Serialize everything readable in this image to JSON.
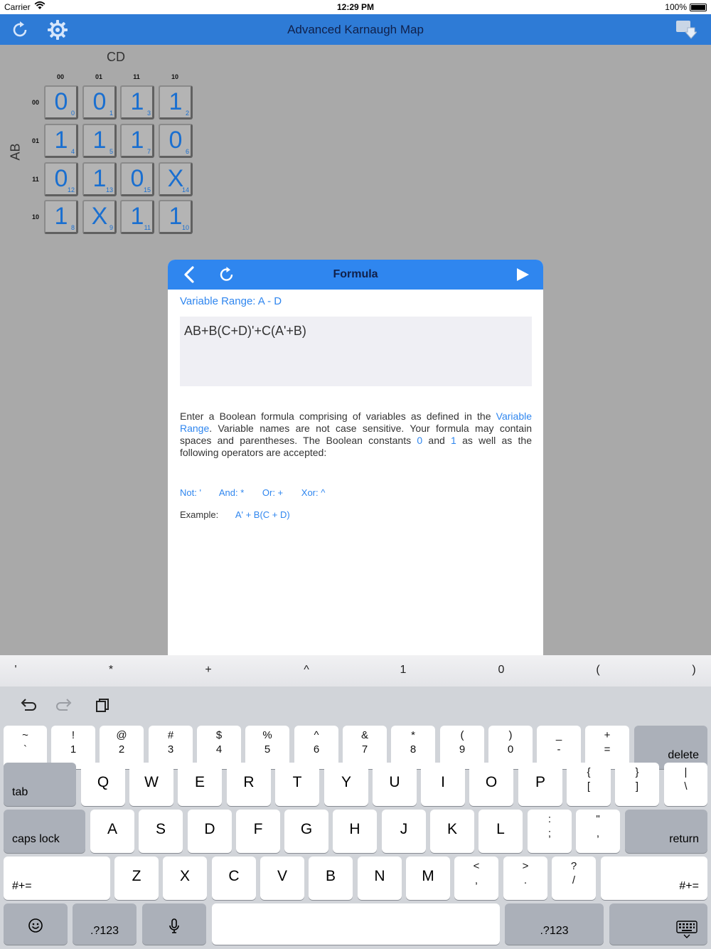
{
  "status_bar": {
    "carrier": "Carrier",
    "time": "12:29 PM",
    "battery": "100%"
  },
  "nav": {
    "title": "Advanced Karnaugh Map"
  },
  "kmap": {
    "col_var": "CD",
    "row_var": "AB",
    "col_headers": [
      "00",
      "01",
      "11",
      "10"
    ],
    "row_headers": [
      "00",
      "01",
      "11",
      "10"
    ],
    "cells": [
      [
        {
          "v": "0",
          "i": "0"
        },
        {
          "v": "0",
          "i": "1"
        },
        {
          "v": "1",
          "i": "3"
        },
        {
          "v": "1",
          "i": "2"
        }
      ],
      [
        {
          "v": "1",
          "i": "4"
        },
        {
          "v": "1",
          "i": "5"
        },
        {
          "v": "1",
          "i": "7"
        },
        {
          "v": "0",
          "i": "6"
        }
      ],
      [
        {
          "v": "0",
          "i": "12"
        },
        {
          "v": "1",
          "i": "13"
        },
        {
          "v": "0",
          "i": "15"
        },
        {
          "v": "X",
          "i": "14"
        }
      ],
      [
        {
          "v": "1",
          "i": "8"
        },
        {
          "v": "X",
          "i": "9"
        },
        {
          "v": "1",
          "i": "11"
        },
        {
          "v": "1",
          "i": "10"
        }
      ]
    ]
  },
  "modal": {
    "title": "Formula",
    "variable_range": "Variable Range: A - D",
    "formula": "AB+B(C+D)'+C(A'+B)",
    "desc": {
      "p1": "Enter a Boolean formula comprising of variables as defined in the ",
      "link": "Variable Range",
      "p2": ". Variable names are not case sensitive. Your formula may contain spaces and parentheses. The Boolean constants ",
      "c0": "0",
      "p3": " and ",
      "c1": "1",
      "p4": " as well as the following operators are accepted:"
    },
    "ops": {
      "not": "Not: '",
      "and": "And: *",
      "or": "Or: +",
      "xor": "Xor: ^"
    },
    "example_label": "Example:",
    "example_value": "A' + B(C + D)"
  },
  "accessory_keys": [
    "'",
    "*",
    "+",
    "^",
    "1",
    "0",
    "(",
    ")"
  ],
  "keyboard": {
    "row1": [
      {
        "t": "~",
        "b": "`"
      },
      {
        "t": "!",
        "b": "1"
      },
      {
        "t": "@",
        "b": "2"
      },
      {
        "t": "#",
        "b": "3"
      },
      {
        "t": "$",
        "b": "4"
      },
      {
        "t": "%",
        "b": "5"
      },
      {
        "t": "^",
        "b": "6"
      },
      {
        "t": "&",
        "b": "7"
      },
      {
        "t": "*",
        "b": "8"
      },
      {
        "t": "(",
        "b": "9"
      },
      {
        "t": ")",
        "b": "0"
      },
      {
        "t": "_",
        "b": "-"
      },
      {
        "t": "+",
        "b": "="
      }
    ],
    "delete": "delete",
    "tab": "tab",
    "row2": [
      "Q",
      "W",
      "E",
      "R",
      "T",
      "Y",
      "U",
      "I",
      "O",
      "P"
    ],
    "row2_sym": [
      {
        "t": "{",
        "b": "["
      },
      {
        "t": "}",
        "b": "]"
      },
      {
        "t": "|",
        "b": "\\"
      }
    ],
    "caps": "caps lock",
    "row3": [
      "A",
      "S",
      "D",
      "F",
      "G",
      "H",
      "J",
      "K",
      "L"
    ],
    "row3_sym": [
      {
        "t": ":",
        "b": ";"
      },
      {
        "t": "\"",
        "b": ","
      }
    ],
    "return": "return",
    "shift_left": "#+=",
    "row4": [
      "Z",
      "X",
      "C",
      "V",
      "B",
      "N",
      "M"
    ],
    "row4_sym": [
      {
        "t": "<",
        "b": ","
      },
      {
        "t": ">",
        "b": "."
      },
      {
        "t": "?",
        "b": "/"
      }
    ],
    "shift_right": "#+=",
    "num_left": ".?123",
    "num_right": ".?123"
  }
}
